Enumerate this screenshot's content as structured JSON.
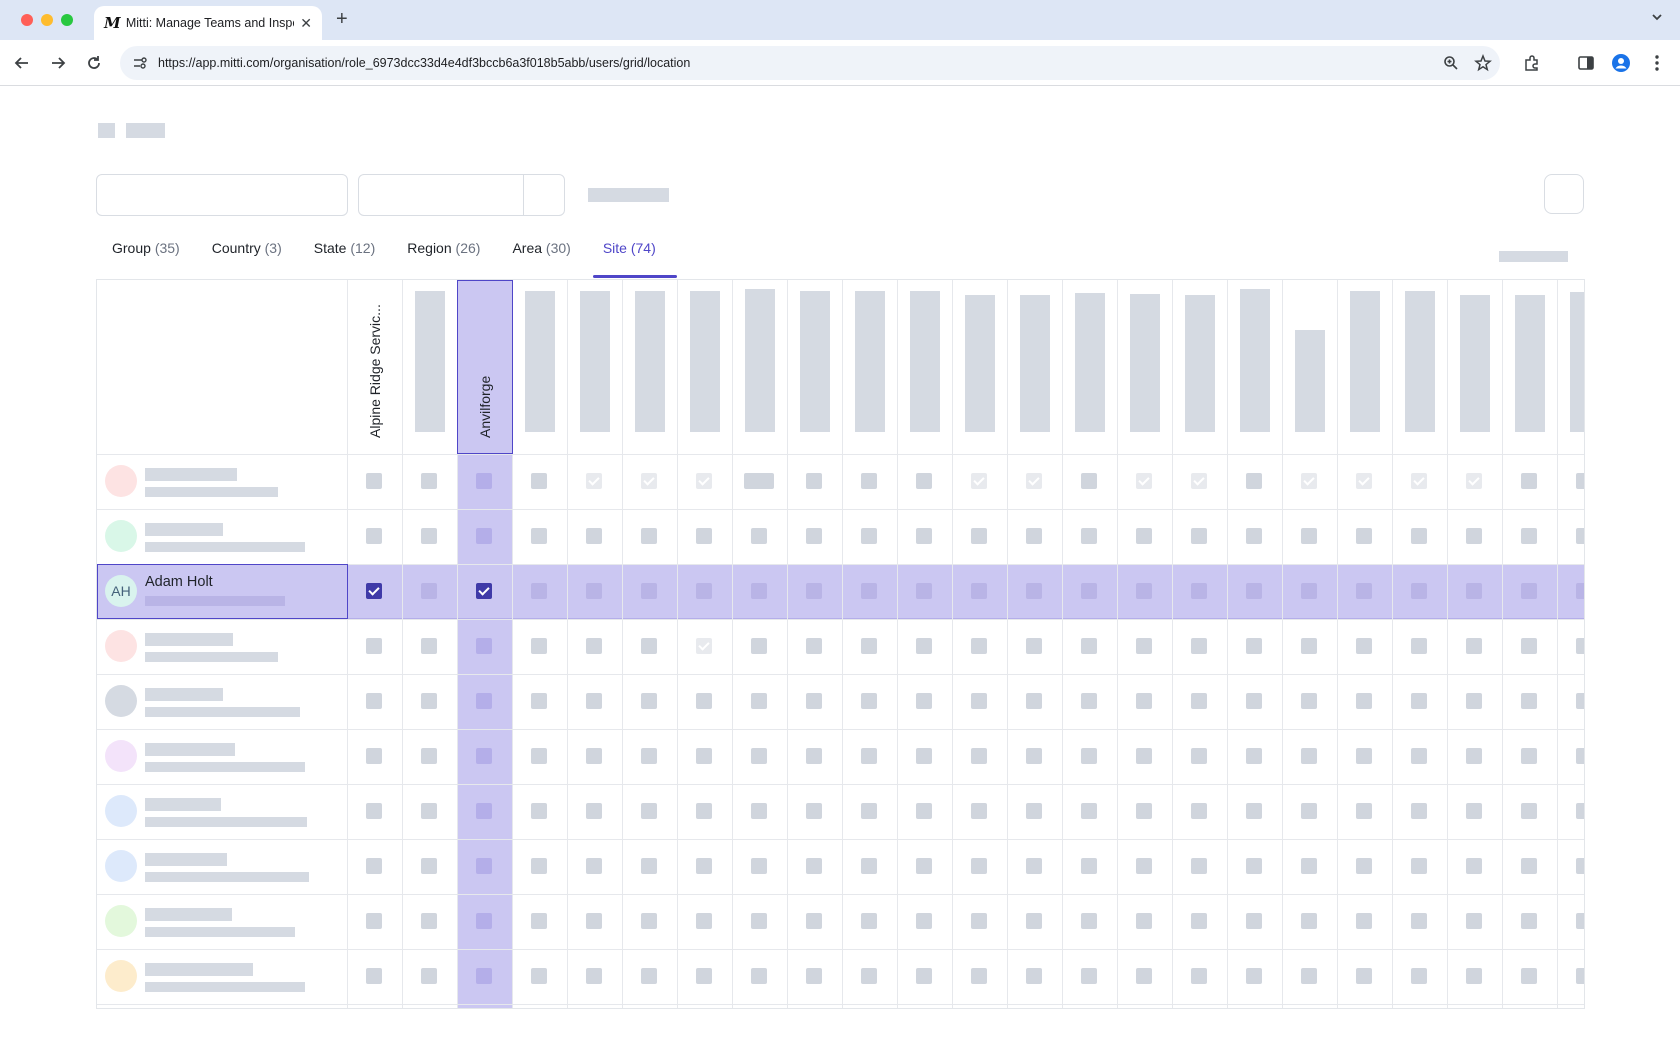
{
  "browser": {
    "tab_title": "Mitti: Manage Teams and Inspect...",
    "tab_favicon": "M",
    "tab_close": "✕",
    "new_tab": "+",
    "url": "https://app.mitti.com/organisation/role_6973dcc33d4e4df3bccb6a3f018b5abb/users/grid/location"
  },
  "location_tabs": [
    {
      "label": "Group",
      "count": "(35)",
      "active": false
    },
    {
      "label": "Country",
      "count": "(3)",
      "active": false
    },
    {
      "label": "State",
      "count": "(12)",
      "active": false
    },
    {
      "label": "Region",
      "count": "(26)",
      "active": false
    },
    {
      "label": "Area",
      "count": "(30)",
      "active": false
    },
    {
      "label": "Site",
      "count": "(74)",
      "active": true
    }
  ],
  "grid": {
    "column_headers": [
      "Alpine Ridge Servic...",
      "Anvilforge"
    ],
    "highlighted_column": "Anvilforge",
    "highlighted_user": {
      "initials": "AH",
      "name": "Adam Holt"
    },
    "avatar_colors": [
      "#fde3e3",
      "#d9f7e8",
      "#d9f3ee",
      "#fde3e3",
      "#d5dae2",
      "#f3e3fa",
      "#dde9fb",
      "#dde9fb",
      "#e3f8dc",
      "#fdeccc"
    ]
  },
  "colors": {
    "accent": "#4f46c8",
    "highlight": "#cbc7f2",
    "skeleton": "#d5dae2"
  }
}
